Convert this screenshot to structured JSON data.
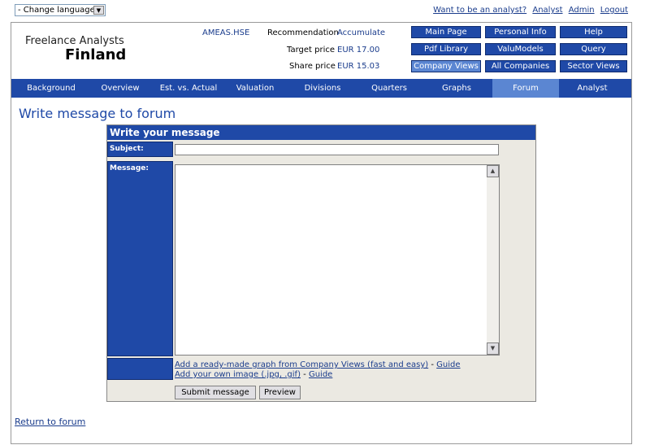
{
  "language_select": {
    "value": "- Change language -"
  },
  "top_links": [
    "Want to be an analyst?",
    "Analyst",
    "Admin",
    "Logout"
  ],
  "brand": {
    "line1": "Freelance Analysts",
    "line2": "Finland"
  },
  "company": {
    "ticker": "AMEAS.HSE",
    "recommendation_label": "Recommendation",
    "recommendation": "Accumulate",
    "target_label": "Target price",
    "target": "EUR 17.00",
    "share_label": "Share price",
    "share": "EUR 15.03"
  },
  "nav_buttons": [
    [
      "Main Page",
      "Personal Info",
      "Help"
    ],
    [
      "Pdf Library",
      "ValuModels",
      "Query"
    ],
    [
      "Company Views",
      "All Companies",
      "Sector Views"
    ]
  ],
  "tabs": [
    "Background",
    "Overview",
    "Est. vs. Actual",
    "Valuation",
    "Divisions",
    "Quarters",
    "Graphs",
    "Forum",
    "Analyst rankings"
  ],
  "active_tab": "Forum",
  "page_title": "Write message to forum",
  "form": {
    "header": "Write your message",
    "subject_label": "Subject:",
    "message_label": "Message:",
    "link1": "Add a ready-made graph from Company Views (fast and easy)",
    "link2": "Add your own image (.jpg, .gif)",
    "guide": "Guide",
    "separator": " - ",
    "submit": "Submit message",
    "preview": "Preview"
  },
  "return_link": "Return to forum"
}
